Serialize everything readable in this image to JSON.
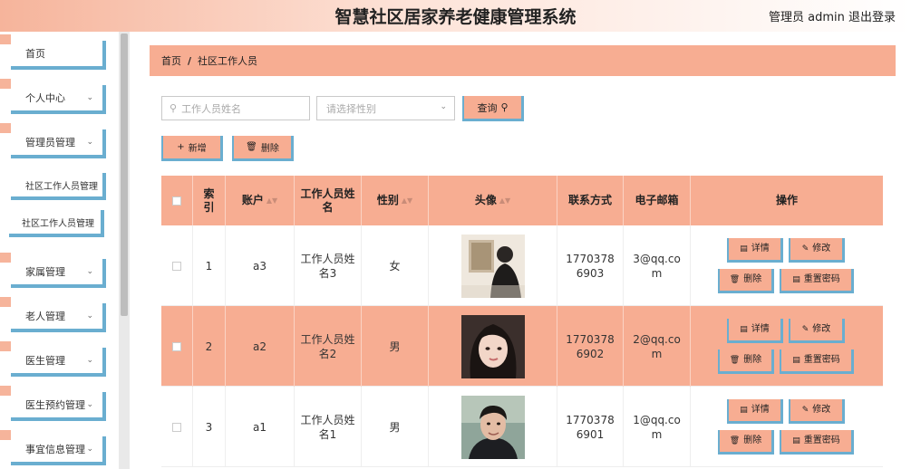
{
  "header": {
    "title": "智慧社区居家养老健康管理系统",
    "user": "管理员 admin",
    "logout": "退出登录"
  },
  "sidebar": {
    "items": [
      {
        "label": "首页",
        "has_chevron": false
      },
      {
        "label": "个人中心",
        "has_chevron": true
      },
      {
        "label": "管理员管理",
        "has_chevron": true
      },
      {
        "label": "社区工作人员管理",
        "has_chevron": false
      },
      {
        "label": "社区工作人员管理",
        "has_chevron": false
      },
      {
        "label": "家属管理",
        "has_chevron": true
      },
      {
        "label": "老人管理",
        "has_chevron": true
      },
      {
        "label": "医生管理",
        "has_chevron": true
      },
      {
        "label": "医生预约管理",
        "has_chevron": true
      },
      {
        "label": "事宜信息管理",
        "has_chevron": true
      }
    ]
  },
  "breadcrumb": {
    "home": "首页",
    "separator": "/",
    "current": "社区工作人员"
  },
  "search": {
    "name_placeholder": "工作人员姓名",
    "gender_placeholder": "请选择性别",
    "query_label": "查询"
  },
  "actions": {
    "add_label": "新增",
    "delete_label": "删除"
  },
  "table": {
    "headers": {
      "index": "索引",
      "account": "账户",
      "name": "工作人员姓名",
      "gender": "性别",
      "avatar": "头像",
      "phone": "联系方式",
      "email": "电子邮箱",
      "ops": "操作"
    },
    "rows": [
      {
        "index": "1",
        "account": "a3",
        "name": "工作人员姓名3",
        "gender": "女",
        "phone": "17703786903",
        "email": "3@qq.com",
        "avatar": "photo-woman-back"
      },
      {
        "index": "2",
        "account": "a2",
        "name": "工作人员姓名2",
        "gender": "男",
        "phone": "17703786902",
        "email": "2@qq.com",
        "avatar": "photo-girl-portrait"
      },
      {
        "index": "3",
        "account": "a1",
        "name": "工作人员姓名1",
        "gender": "男",
        "phone": "17703786901",
        "email": "1@qq.com",
        "avatar": "photo-man-portrait"
      }
    ],
    "op_labels": {
      "detail": "详情",
      "edit": "修改",
      "delete": "删除",
      "reset": "重置密码"
    }
  },
  "colors": {
    "accent": "#f7ad92",
    "border_blue": "#6aaed0"
  }
}
